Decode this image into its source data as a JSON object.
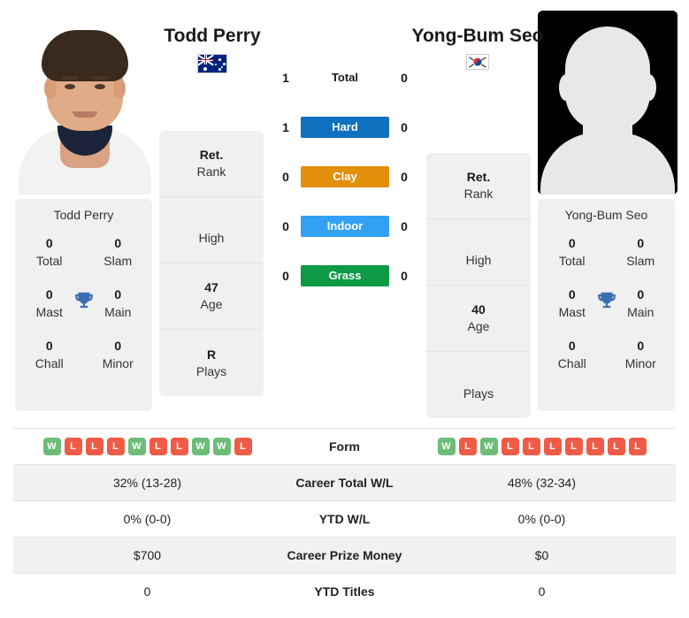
{
  "players": {
    "left": {
      "name": "Todd Perry",
      "flag_icon": "flag-australia",
      "photo_type": "photo",
      "card_name": "Todd Perry",
      "info": [
        {
          "value": "Ret.",
          "label": "Rank"
        },
        {
          "value": "",
          "label": "High"
        },
        {
          "value": "47",
          "label": "Age"
        },
        {
          "value": "R",
          "label": "Plays"
        }
      ],
      "titles": [
        {
          "value": "0",
          "label": "Total"
        },
        {
          "value": "0",
          "label": "Slam"
        },
        {
          "value": "0",
          "label": "Mast"
        },
        {
          "value": "0",
          "label": "Main"
        },
        {
          "value": "0",
          "label": "Chall"
        },
        {
          "value": "0",
          "label": "Minor"
        }
      ],
      "form": [
        "W",
        "L",
        "L",
        "L",
        "W",
        "L",
        "L",
        "W",
        "W",
        "L"
      ],
      "stats": {
        "career_total_wl": "32% (13-28)",
        "ytd_wl": "0% (0-0)",
        "career_prize_money": "$700",
        "ytd_titles": "0"
      }
    },
    "right": {
      "name": "Yong-Bum Seo",
      "flag_icon": "flag-south-korea",
      "photo_type": "silhouette",
      "card_name": "Yong-Bum Seo",
      "info": [
        {
          "value": "Ret.",
          "label": "Rank"
        },
        {
          "value": "",
          "label": "High"
        },
        {
          "value": "40",
          "label": "Age"
        },
        {
          "value": "",
          "label": "Plays"
        }
      ],
      "titles": [
        {
          "value": "0",
          "label": "Total"
        },
        {
          "value": "0",
          "label": "Slam"
        },
        {
          "value": "0",
          "label": "Mast"
        },
        {
          "value": "0",
          "label": "Main"
        },
        {
          "value": "0",
          "label": "Chall"
        },
        {
          "value": "0",
          "label": "Minor"
        }
      ],
      "form": [
        "W",
        "L",
        "W",
        "L",
        "L",
        "L",
        "L",
        "L",
        "L",
        "L"
      ],
      "stats": {
        "career_total_wl": "48% (32-34)",
        "ytd_wl": "0% (0-0)",
        "career_prize_money": "$0",
        "ytd_titles": "0"
      }
    }
  },
  "surfaces": [
    {
      "label": "Total",
      "left": "1",
      "right": "0",
      "color": "",
      "plain": true
    },
    {
      "label": "Hard",
      "left": "1",
      "right": "0",
      "color": "#0f71c0"
    },
    {
      "label": "Clay",
      "left": "0",
      "right": "0",
      "color": "#e28f0c"
    },
    {
      "label": "Indoor",
      "left": "0",
      "right": "0",
      "color": "#32a0f5"
    },
    {
      "label": "Grass",
      "left": "0",
      "right": "0",
      "color": "#0c9b44"
    }
  ],
  "table": {
    "form_label": "Form",
    "rows": [
      {
        "label": "Career Total W/L",
        "left": "32% (13-28)",
        "right": "48% (32-34)"
      },
      {
        "label": "YTD W/L",
        "left": "0% (0-0)",
        "right": "0% (0-0)"
      },
      {
        "label": "Career Prize Money",
        "left": "$700",
        "right": "$0"
      },
      {
        "label": "YTD Titles",
        "left": "0",
        "right": "0"
      }
    ]
  },
  "icons": {
    "trophy": "trophy-icon"
  },
  "colors": {
    "win": "#6dbd78",
    "loss": "#ef5b46",
    "trophy": "#3c6eb4"
  }
}
